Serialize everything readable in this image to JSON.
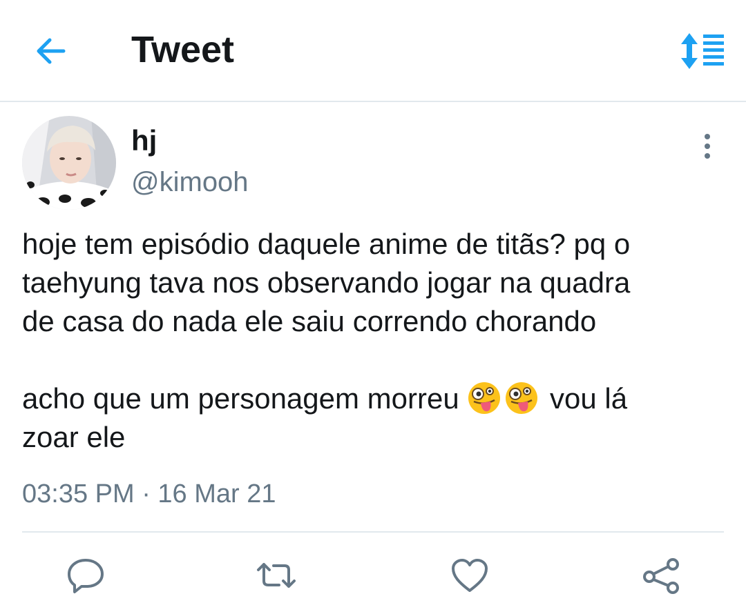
{
  "header": {
    "title": "Tweet",
    "back_icon": "arrow-left-icon",
    "sort_icon": "sort-list-icon"
  },
  "tweet": {
    "author": {
      "display_name": "hj",
      "handle": "@kimooh"
    },
    "text": {
      "line1": "hoje tem episódio daquele anime de titãs? pq o",
      "line2": "taehyung tava nos observando jogar na quadra",
      "line3": "de casa do nada ele saiu correndo chorando",
      "line4_start": "acho que um personagem morreu",
      "line4_end": "vou lá",
      "line5": "zoar ele",
      "emoji": "zany-face-icon"
    },
    "timestamp": "03:35 PM · 16 Mar 21"
  },
  "actions": {
    "reply_icon": "reply-icon",
    "retweet_icon": "retweet-icon",
    "like_icon": "heart-icon",
    "share_icon": "share-icon"
  },
  "colors": {
    "accent": "#1da1f2",
    "text": "#14171a",
    "secondary": "#657786",
    "divider": "#e1e8ed"
  }
}
